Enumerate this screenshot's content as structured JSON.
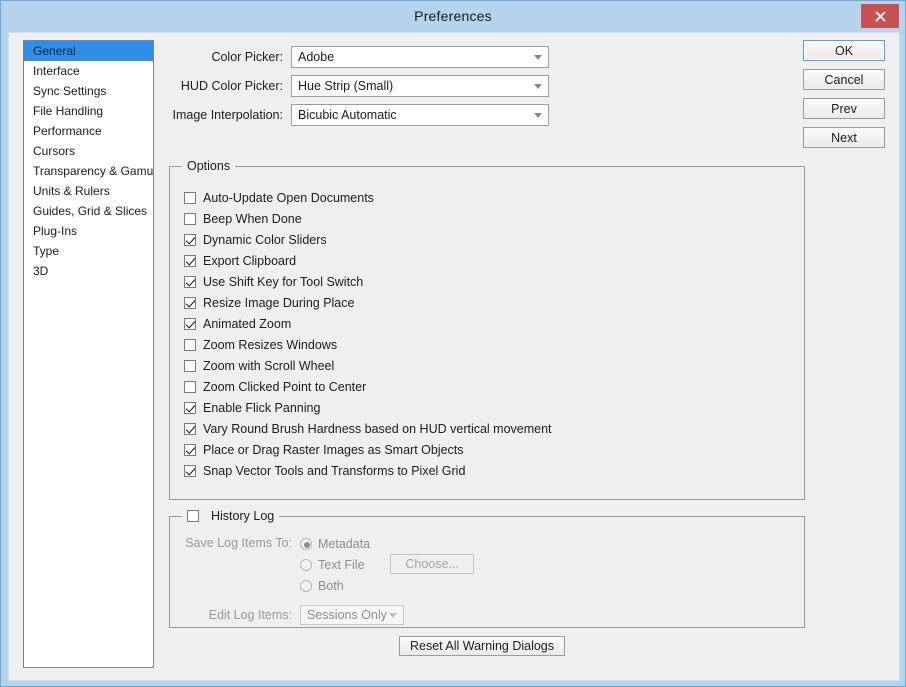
{
  "window": {
    "title": "Preferences",
    "close_label": "Close",
    "accent_blue": "#b4d4ee",
    "selection_blue": "#2f8fe8",
    "close_red": "#c9514f",
    "dialog_bg": "#efefef"
  },
  "sidebar": {
    "items": [
      {
        "label": "General",
        "selected": true
      },
      {
        "label": "Interface",
        "selected": false
      },
      {
        "label": "Sync Settings",
        "selected": false
      },
      {
        "label": "File Handling",
        "selected": false
      },
      {
        "label": "Performance",
        "selected": false
      },
      {
        "label": "Cursors",
        "selected": false
      },
      {
        "label": "Transparency & Gamut",
        "selected": false
      },
      {
        "label": "Units & Rulers",
        "selected": false
      },
      {
        "label": "Guides, Grid & Slices",
        "selected": false
      },
      {
        "label": "Plug-Ins",
        "selected": false
      },
      {
        "label": "Type",
        "selected": false
      },
      {
        "label": "3D",
        "selected": false
      }
    ]
  },
  "combos": [
    {
      "label": "Color Picker:",
      "value": "Adobe"
    },
    {
      "label": "HUD Color Picker:",
      "value": "Hue Strip (Small)"
    },
    {
      "label": "Image Interpolation:",
      "value": "Bicubic Automatic"
    }
  ],
  "options_group": {
    "legend": "Options",
    "items": [
      {
        "label": "Auto-Update Open Documents",
        "checked": false
      },
      {
        "label": "Beep When Done",
        "checked": false
      },
      {
        "label": "Dynamic Color Sliders",
        "checked": true
      },
      {
        "label": "Export Clipboard",
        "checked": true
      },
      {
        "label": "Use Shift Key for Tool Switch",
        "checked": true
      },
      {
        "label": "Resize Image During Place",
        "checked": true
      },
      {
        "label": "Animated Zoom",
        "checked": true
      },
      {
        "label": "Zoom Resizes Windows",
        "checked": false
      },
      {
        "label": "Zoom with Scroll Wheel",
        "checked": false
      },
      {
        "label": "Zoom Clicked Point to Center",
        "checked": false
      },
      {
        "label": "Enable Flick Panning",
        "checked": true
      },
      {
        "label": "Vary Round Brush Hardness based on HUD vertical movement",
        "checked": true
      },
      {
        "label": "Place or Drag Raster Images as Smart Objects",
        "checked": true
      },
      {
        "label": "Snap Vector Tools and Transforms to Pixel Grid",
        "checked": true
      }
    ]
  },
  "history_log": {
    "legend": "History Log",
    "enabled": false,
    "save_log_label": "Save Log Items To:",
    "radios": [
      {
        "label": "Metadata",
        "selected": true
      },
      {
        "label": "Text File",
        "selected": false
      },
      {
        "label": "Both",
        "selected": false
      }
    ],
    "choose_button": "Choose...",
    "edit_log_label": "Edit Log Items:",
    "edit_log_value": "Sessions Only"
  },
  "reset_button": "Reset All Warning Dialogs",
  "side_buttons": [
    {
      "label": "OK",
      "default": true
    },
    {
      "label": "Cancel",
      "default": false
    },
    {
      "label": "Prev",
      "default": false
    },
    {
      "label": "Next",
      "default": false
    }
  ]
}
